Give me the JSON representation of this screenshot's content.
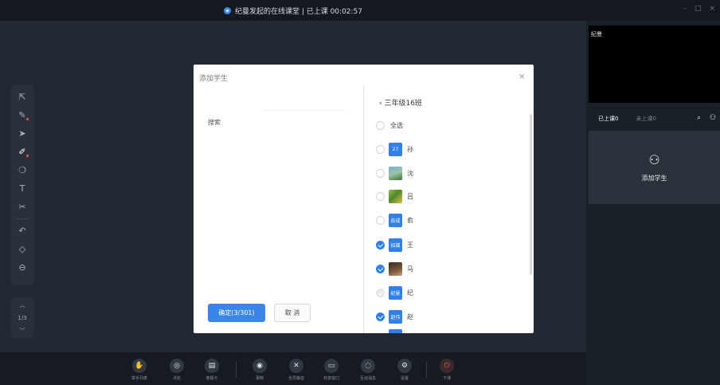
{
  "window": {
    "title": "纪曼发起的在线课堂 | 已上课 00:02:57",
    "controls": [
      "–",
      "□",
      "×"
    ]
  },
  "toolbar": {
    "tools": [
      {
        "name": "pointer-out-icon",
        "glyph": "⇱"
      },
      {
        "name": "laser-pen-icon",
        "glyph": "✎"
      },
      {
        "name": "select-arrow-icon",
        "glyph": "➤"
      },
      {
        "name": "pen-icon",
        "glyph": "✐"
      },
      {
        "name": "shapes-icon",
        "glyph": "❍"
      },
      {
        "name": "text-icon",
        "glyph": "T"
      },
      {
        "name": "scissors-icon",
        "glyph": "✂"
      },
      {
        "name": "undo-icon",
        "glyph": "↶"
      },
      {
        "name": "eraser-icon",
        "glyph": "◇"
      },
      {
        "name": "clear-icon",
        "glyph": "⊖"
      }
    ]
  },
  "pager": {
    "up": "︿",
    "page": "1/3",
    "down": "﹀"
  },
  "bottombar": {
    "buttons": [
      {
        "label": "举手列表",
        "icon": "✋"
      },
      {
        "label": "点名",
        "icon": "◎"
      },
      {
        "label": "答题卡",
        "icon": "▤"
      },
      {
        "label": "录制",
        "icon": "◉"
      },
      {
        "label": "全员静音",
        "icon": "✕"
      },
      {
        "label": "共享窗口",
        "icon": "▭"
      },
      {
        "label": "互动消息",
        "icon": "◌"
      },
      {
        "label": "设置",
        "icon": "⚙"
      },
      {
        "label": "下课",
        "icon": "⏻"
      }
    ]
  },
  "right_panel": {
    "video_name": "纪曼",
    "tab_attended": "已上课0",
    "tab_absent": "未上课0",
    "add_student_label": "添加学生"
  },
  "modal": {
    "title": "添加学生",
    "close": "×",
    "search_label": "搜索",
    "confirm_label": "确定(3/301)",
    "cancel_label": "取 消",
    "class_back": "‹",
    "class_name": "三年级16班",
    "select_all": "全选",
    "students": [
      {
        "avatar_text": "27",
        "avatar_style": "blue",
        "name": "孙",
        "state": "off"
      },
      {
        "avatar_text": "",
        "avatar_style": "photo1",
        "name": "沈",
        "state": "off"
      },
      {
        "avatar_text": "",
        "avatar_style": "photo2",
        "name": "吕",
        "state": "off"
      },
      {
        "avatar_text": "俞成",
        "avatar_style": "blue",
        "name": "俞",
        "state": "off"
      },
      {
        "avatar_text": "招娣",
        "avatar_style": "blue",
        "name": "王",
        "state": "on"
      },
      {
        "avatar_text": "",
        "avatar_style": "photo3",
        "name": "马",
        "state": "on"
      },
      {
        "avatar_text": "纪曼",
        "avatar_style": "blue",
        "name": "纪",
        "state": "disabled"
      },
      {
        "avatar_text": "赵伟",
        "avatar_style": "blue",
        "name": "赵",
        "state": "on"
      }
    ]
  }
}
